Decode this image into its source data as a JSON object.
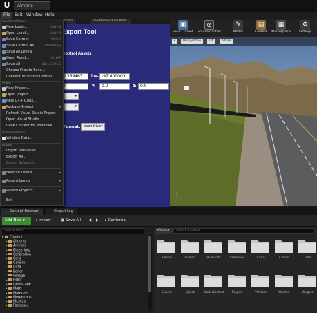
{
  "app": {
    "project_tab": "Almono",
    "menus": [
      "File",
      "Edit",
      "Window",
      "Help"
    ]
  },
  "file_menu": {
    "sections": {
      "load_save": "Load and Save",
      "project": "Project",
      "datavalidation": "DataValidation",
      "actors": "Actors"
    },
    "items": [
      {
        "label": "New Level...",
        "key": "Ctrl+N"
      },
      {
        "label": "Open Level...",
        "key": "Ctrl+O"
      },
      {
        "label": "Save Current",
        "key": "Ctrl+S"
      },
      {
        "label": "Save Current As...",
        "key": "Ctrl+Alt+S"
      },
      {
        "label": "Save All Levels",
        "key": ""
      },
      {
        "label": "Open Asset...",
        "key": "Ctrl+P"
      },
      {
        "label": "Save All",
        "key": "Ctrl+Shift+S"
      },
      {
        "label": "Choose Files to Save...",
        "key": ""
      },
      {
        "label": "Connect To Source Control...",
        "key": ""
      },
      {
        "label": "New Project...",
        "key": ""
      },
      {
        "label": "Open Project...",
        "key": ""
      },
      {
        "label": "New C++ Class...",
        "key": ""
      },
      {
        "label": "Package Project",
        "key": ""
      },
      {
        "label": "Refresh Visual Studio Project",
        "key": ""
      },
      {
        "label": "Open Visual Studio",
        "key": ""
      },
      {
        "label": "Cook Content for Windows",
        "key": ""
      },
      {
        "label": "Validate Data...",
        "key": ""
      },
      {
        "label": "Import Into Level...",
        "key": ""
      },
      {
        "label": "Export All...",
        "key": ""
      },
      {
        "label": "Export Selected...",
        "key": ""
      },
      {
        "label": "Favorite Levels",
        "key": ""
      },
      {
        "label": "Recent Levels",
        "key": ""
      },
      {
        "label": "Recent Projects",
        "key": ""
      },
      {
        "label": "Exit",
        "key": ""
      }
    ]
  },
  "editor_tabs": [
    "Actors",
    "RoadNetworkToolMod"
  ],
  "export_panel": {
    "title": "Export Tool",
    "control_assets": "Control Assets",
    "lat_value": "0.369467",
    "lng_label": "lng:",
    "lng_value": "-97.800003",
    "x_value": "0",
    "y_label": "Y:",
    "y_value": "0.0",
    "z_label": "Z:",
    "z_value": "0.0",
    "format_label": "Format:",
    "format_value": "opendrive"
  },
  "toolbar": [
    {
      "label": "Save Current",
      "icon": "save-icon"
    },
    {
      "label": "Source Control",
      "icon": "source-control-icon"
    },
    {
      "label": "Modes",
      "icon": "modes-icon"
    },
    {
      "label": "Content",
      "icon": "content-icon"
    },
    {
      "label": "Marketplace",
      "icon": "marketplace-icon"
    },
    {
      "label": "Settings",
      "icon": "gear-icon"
    }
  ],
  "viewport": {
    "perspective": "Perspective",
    "lit": "Lit",
    "show": "Show"
  },
  "content_browser": {
    "tabs": [
      "Content Browser",
      "Output Log"
    ],
    "add_new": "Add New",
    "import": "Import",
    "save_all": "Save All",
    "path": "Content",
    "search_paths": "Search Paths",
    "filters": "Filters",
    "search_content": "Search Content"
  },
  "folders": [
    "Content",
    "Almono",
    "Animals",
    "Blueprints",
    "Calibration",
    "Carla",
    "CarSim",
    "Data",
    "Editor",
    "Foliage",
    "HUD",
    "Landscape",
    "Maps",
    "Materials",
    "Megascans",
    "Meshes",
    "Packages"
  ],
  "assets": [
    "Almono",
    "Animals",
    "Blueprints",
    "Calibration",
    "Carla",
    "CarSim",
    "Data",
    "Servers",
    "Splash",
    "StarterContent",
    "Triggers",
    "Vehicles",
    "Weather",
    "Widgets"
  ],
  "colors": {
    "export_bg": "#2a2a7a",
    "add_new": "#3d8b37",
    "folder": "#c8a35a"
  }
}
